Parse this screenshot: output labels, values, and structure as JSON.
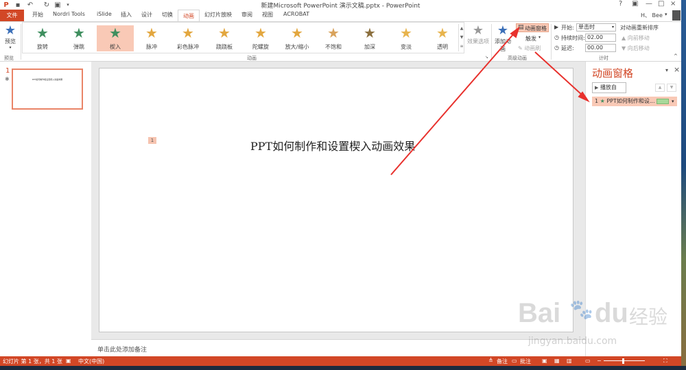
{
  "window": {
    "title": "新建Microsoft PowerPoint 演示文稿.pptx - PowerPoint",
    "help": "?",
    "minimize": "—",
    "restore": "□",
    "close": "×"
  },
  "user": {
    "name": "H、 Bee",
    "dropdown": "▾"
  },
  "tabs": [
    {
      "label": "文件",
      "active": false
    },
    {
      "label": "开始"
    },
    {
      "label": "Nordri Tools"
    },
    {
      "label": "iSlide"
    },
    {
      "label": "插入"
    },
    {
      "label": "设计"
    },
    {
      "label": "切换"
    },
    {
      "label": "动画",
      "active": true
    },
    {
      "label": "幻灯片放映"
    },
    {
      "label": "审阅"
    },
    {
      "label": "视图"
    },
    {
      "label": "ACROBAT"
    }
  ],
  "ribbon": {
    "preview": {
      "label": "预览",
      "group": "预览"
    },
    "gallery": [
      {
        "label": "旋转",
        "color": "#3f8f5f"
      },
      {
        "label": "弹跳",
        "color": "#3f8f5f"
      },
      {
        "label": "楔入",
        "color": "#3f8f5f",
        "selected": true
      },
      {
        "label": "脉冲",
        "color": "#e3a73f"
      },
      {
        "label": "彩色脉冲",
        "color": "#e3a73f"
      },
      {
        "label": "跷跷板",
        "color": "#e3a73f"
      },
      {
        "label": "陀螺旋",
        "color": "#e3a73f"
      },
      {
        "label": "放大/缩小",
        "color": "#e3a73f"
      },
      {
        "label": "不饱和",
        "color": "#d9a35c"
      },
      {
        "label": "加深",
        "color": "#8b6f3e"
      },
      {
        "label": "变淡",
        "color": "#e8b44d"
      },
      {
        "label": "透明",
        "color": "#e8b44d"
      }
    ],
    "animation_group": "动画",
    "effect_options": "效果选项",
    "add_animation": "添加动画",
    "animation_pane_btn": "动画窗格",
    "trigger": "触发",
    "animation_painter": "动画刷",
    "advanced_group": "高级动画",
    "start_label": "开始:",
    "start_value": "单击时",
    "duration_label": "持续时间:",
    "duration_value": "02.00",
    "delay_label": "延迟:",
    "delay_value": "00.00",
    "reorder_title": "对动画重新排序",
    "move_earlier": "▲ 向前移动",
    "move_later": "▼ 向后移动",
    "timing_group": "计时"
  },
  "slides": {
    "number": "1",
    "thumb_text": "PPT如何制作和设置楔入动画效果"
  },
  "slide": {
    "title": "PPT如何制作和设置楔入动画效果",
    "anim_tag": "1"
  },
  "notes": {
    "placeholder": "单击此处添加备注"
  },
  "animpane": {
    "title": "动画窗格",
    "play": "播放自",
    "item_index": "1",
    "item_text": "PPT如何制作和设...",
    "up": "▲",
    "down": "▼"
  },
  "status": {
    "slide_info": "幻灯片 第 1 张，共 1 张",
    "language": "中文(中国)",
    "notes": "备注",
    "comments": "批注"
  },
  "watermark": {
    "brand": "Bai",
    "brand2": "du",
    "cn": "经验",
    "url": "jingyan.baidu.com"
  },
  "colors": {
    "accent": "#d24726",
    "selected": "#f9c9b6",
    "arrow": "#e8312d"
  }
}
